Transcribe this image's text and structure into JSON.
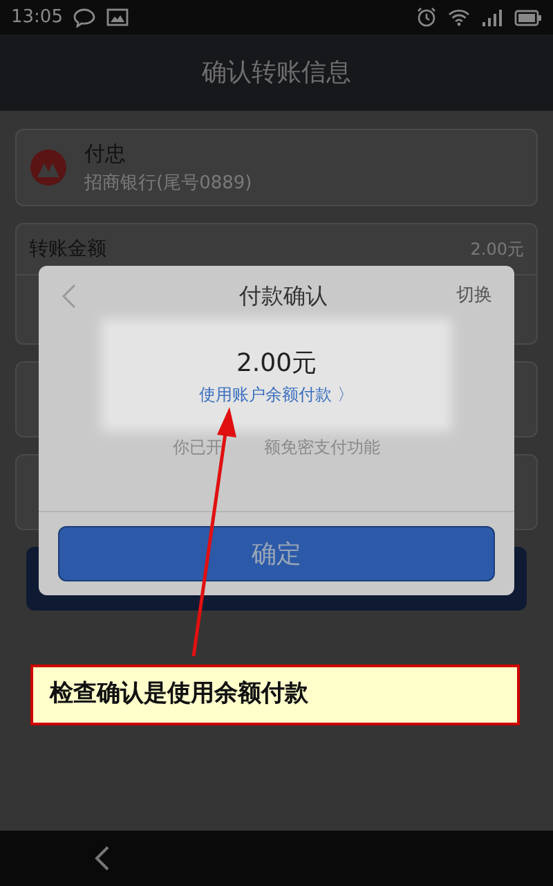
{
  "status_bar": {
    "time": "13:05"
  },
  "title": "确认转账信息",
  "payee": {
    "name": "付忠",
    "bank": "招商银行(尾号0889)"
  },
  "amount_row": {
    "label": "转账金额",
    "value": "2.00元"
  },
  "dialog": {
    "title": "付款确认",
    "switch": "切换",
    "amount": "2.00元",
    "method": "使用账户余额付款 〉",
    "note_parts": [
      "你已开",
      "额免密支付功能"
    ],
    "confirm": "确定"
  },
  "callout": "检查确认是使用余额付款"
}
